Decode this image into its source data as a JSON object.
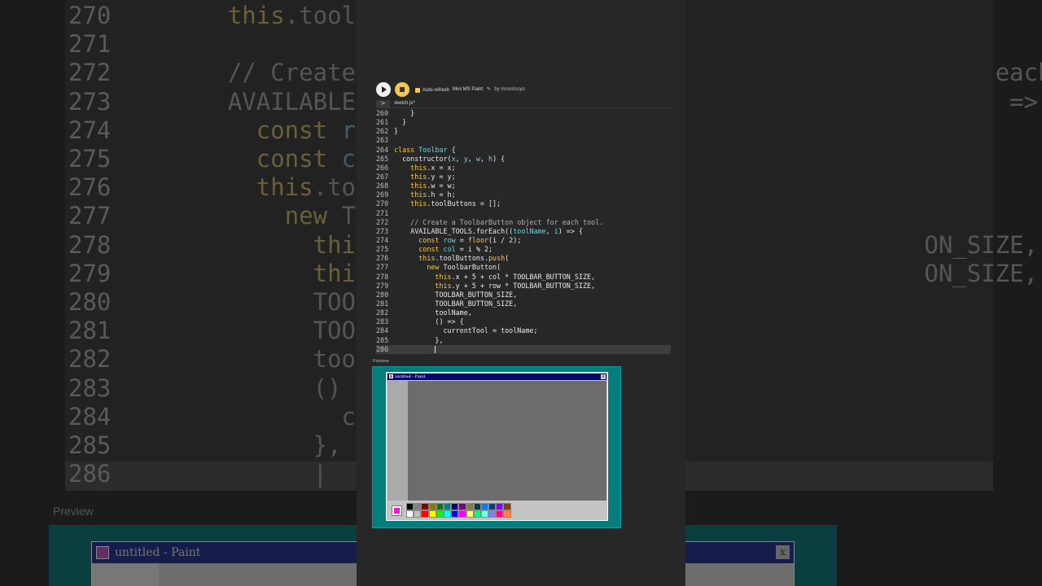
{
  "toolbar": {
    "auto_refresh_label": "Auto-refresh",
    "sketch_name": "Mini MS Paint",
    "author": "by moontsoyo"
  },
  "tab": {
    "toggle_glyph": ">",
    "file_name": "sketch.js*"
  },
  "code_lines": [
    {
      "n": "260",
      "html": "    }"
    },
    {
      "n": "261",
      "html": "  }"
    },
    {
      "n": "262",
      "html": "}"
    },
    {
      "n": "263",
      "html": ""
    },
    {
      "n": "264",
      "html": "<span class=\"t-kw\">class</span> <span class=\"t-cls\">Toolbar</span> {"
    },
    {
      "n": "265",
      "html": "  constructor(<span class=\"t-cls\">x</span>, <span class=\"t-cls\">y</span>, <span class=\"t-cls\">w</span>, <span class=\"t-cls\">h</span>) {"
    },
    {
      "n": "266",
      "html": "    <span class=\"t-kw\">this</span>.x = x;"
    },
    {
      "n": "267",
      "html": "    <span class=\"t-kw\">this</span>.y = y;"
    },
    {
      "n": "268",
      "html": "    <span class=\"t-kw\">this</span>.w = w;"
    },
    {
      "n": "269",
      "html": "    <span class=\"t-kw\">this</span>.h = h;"
    },
    {
      "n": "270",
      "html": "    <span class=\"t-kw\">this</span>.toolButtons = [];"
    },
    {
      "n": "271",
      "html": ""
    },
    {
      "n": "272",
      "html": "    <span class=\"t-cm\">// Create a ToolbarButton object for each tool.</span>"
    },
    {
      "n": "273",
      "html": "    AVAILABLE_TOOLS.forEach((<span class=\"t-cls\">toolName</span>, <span class=\"t-cls\">i</span>) => {"
    },
    {
      "n": "274",
      "html": "      <span class=\"t-kw\">const</span> <span class=\"t-cls\">row</span> = <span class=\"t-kw\">floor</span>(i / 2);"
    },
    {
      "n": "275",
      "html": "      <span class=\"t-kw\">const</span> <span class=\"t-cls\">col</span> = i % 2;"
    },
    {
      "n": "276",
      "html": "      <span class=\"t-kw\">this</span>.toolButtons.<span class=\"t-kw\">push</span>("
    },
    {
      "n": "277",
      "html": "        <span class=\"t-kw\">new</span> ToolbarButton("
    },
    {
      "n": "278",
      "html": "          <span class=\"t-kw\">this</span>.x + 5 + col * TOOLBAR_BUTTON_SIZE,"
    },
    {
      "n": "279",
      "html": "          <span class=\"t-kw\">this</span>.y + 5 + row * TOOLBAR_BUTTON_SIZE,"
    },
    {
      "n": "280",
      "html": "          TOOLBAR_BUTTON_SIZE,"
    },
    {
      "n": "281",
      "html": "          TOOLBAR_BUTTON_SIZE,"
    },
    {
      "n": "282",
      "html": "          toolName,"
    },
    {
      "n": "283",
      "html": "          () => {"
    },
    {
      "n": "284",
      "html": "            currentTool = toolName;"
    },
    {
      "n": "285",
      "html": "          },"
    },
    {
      "n": "286",
      "html": "          ",
      "current": true
    }
  ],
  "preview_label": "Preview",
  "paint": {
    "title": "untitled - Paint",
    "close_glyph": "x",
    "current_color": "#e11ec8",
    "palette_top": [
      "#000000",
      "#808080",
      "#800000",
      "#808000",
      "#008000",
      "#008080",
      "#000080",
      "#800080",
      "#808040",
      "#004040",
      "#0080ff",
      "#004080",
      "#8000ff",
      "#804000"
    ],
    "palette_bottom": [
      "#ffffff",
      "#c0c0c0",
      "#ff0000",
      "#ffff00",
      "#00ff00",
      "#00ffff",
      "#0000ff",
      "#ff00ff",
      "#ffff80",
      "#00ff80",
      "#80ffff",
      "#8080ff",
      "#ff0080",
      "#ff8040"
    ]
  },
  "background": {
    "code_lines": [
      {
        "n": "270",
        "html": "    <span class=\"kw\">this</span>.toolButt"
      },
      {
        "n": "271",
        "html": ""
      },
      {
        "n": "272",
        "html": "    <span class=\"cm\">// Create a To</span>                                        <span class=\"cm\">each tool.</span>"
      },
      {
        "n": "273",
        "html": "    AVAILABLE_TOOL                                         => {"
      },
      {
        "n": "274",
        "html": "      <span class=\"kw\">const</span> <span class=\"cls\">row</span> ="
      },
      {
        "n": "275",
        "html": "      <span class=\"kw\">const</span> <span class=\"cls\">col</span> ="
      },
      {
        "n": "276",
        "html": "      <span class=\"kw\">this</span>.toolBut"
      },
      {
        "n": "277",
        "html": "        <span class=\"kw\">new</span> Toolba"
      },
      {
        "n": "278",
        "html": "          <span class=\"kw\">this</span>.x -                                   ON_SIZE,"
      },
      {
        "n": "279",
        "html": "          <span class=\"kw\">this</span>.y -                                   ON_SIZE,"
      },
      {
        "n": "280",
        "html": "          TOOLBAR_"
      },
      {
        "n": "281",
        "html": "          TOOLBAR_"
      },
      {
        "n": "282",
        "html": "          toolName"
      },
      {
        "n": "283",
        "html": "          () => {"
      },
      {
        "n": "284",
        "html": "            curren"
      },
      {
        "n": "285",
        "html": "          },"
      },
      {
        "n": "286",
        "html": "          |"
      }
    ],
    "preview_label": "Preview",
    "paint_title": "untitled - Paint"
  }
}
